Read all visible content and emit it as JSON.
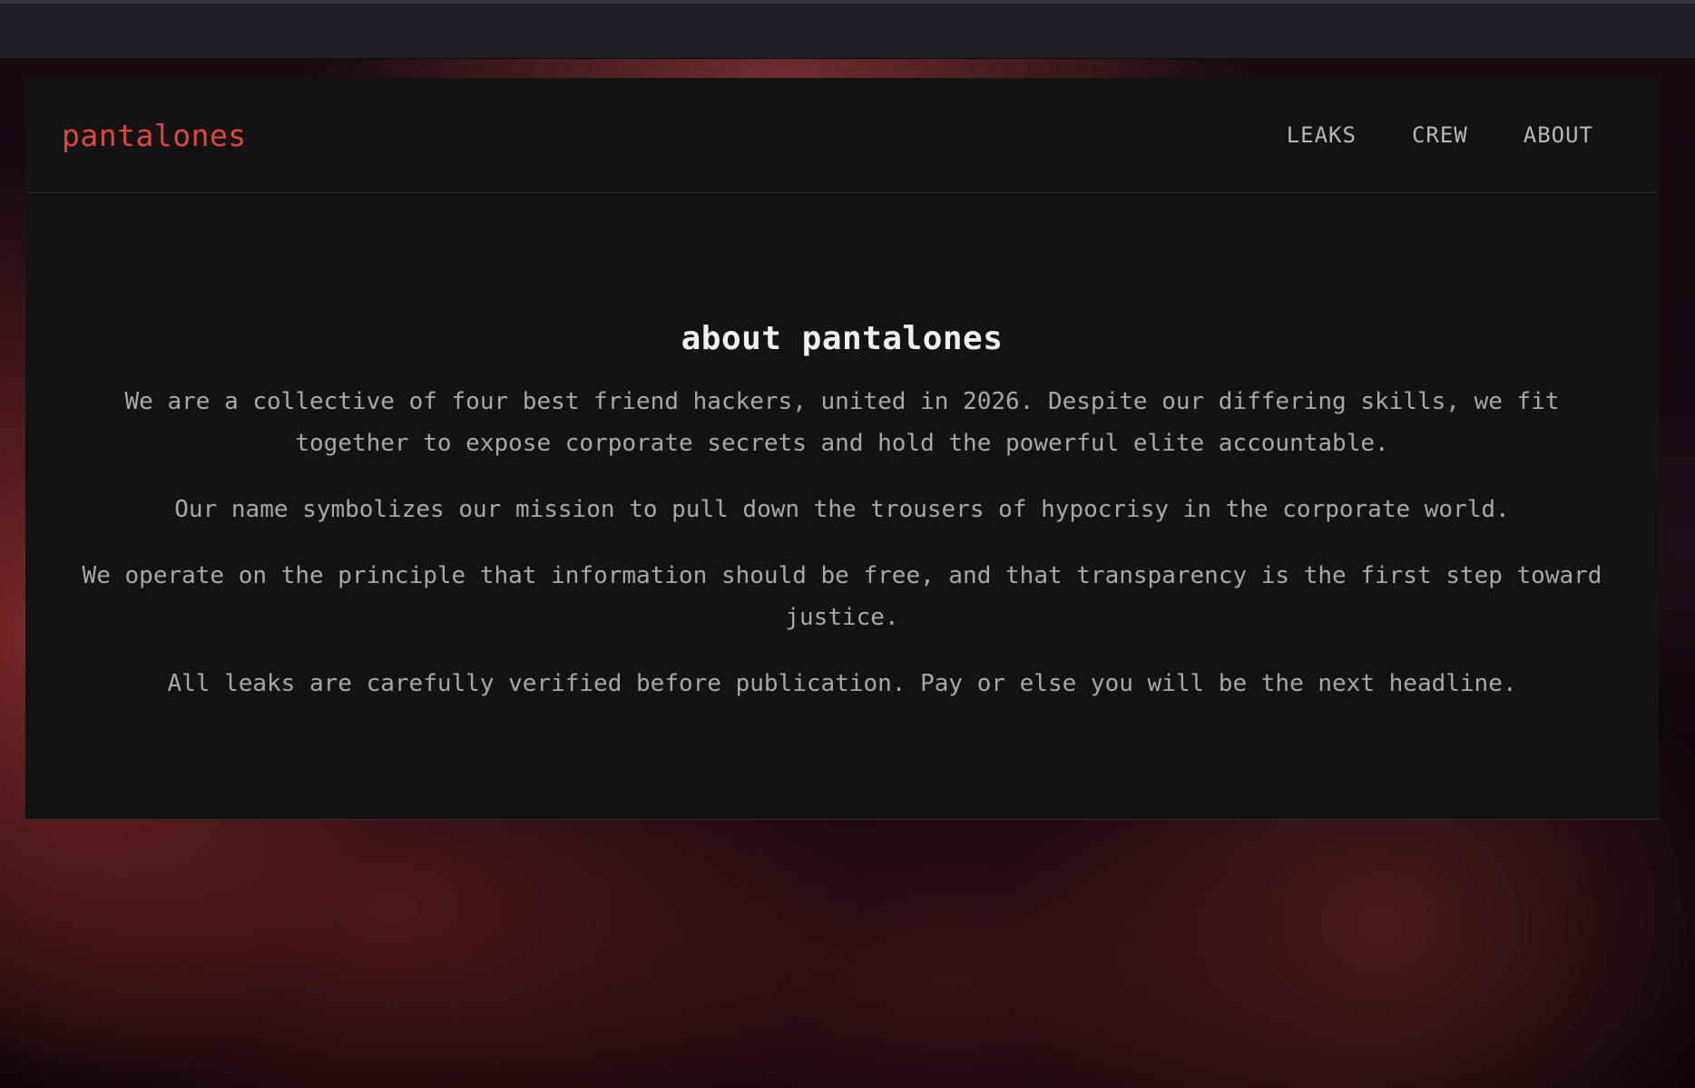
{
  "brand": "pantalones",
  "nav": {
    "items": [
      {
        "label": "LEAKS"
      },
      {
        "label": "CREW"
      },
      {
        "label": "ABOUT"
      }
    ]
  },
  "about": {
    "title": "about pantalones",
    "paragraphs": [
      "We are a collective of four best friend hackers, united in 2026. Despite our differing skills, we fit together to expose corporate secrets and hold the powerful elite accountable.",
      "Our name symbolizes our mission to pull down the trousers of hypocrisy in the corporate world.",
      "We operate on the principle that information should be free, and that transparency is the first step toward justice.",
      "All leaks are carefully verified before publication. Pay or else you will be the next headline."
    ]
  },
  "colors": {
    "accent": "#e0473c",
    "panel": "#131313",
    "text": "#a8a8a8",
    "heading": "#f0f0f0"
  }
}
